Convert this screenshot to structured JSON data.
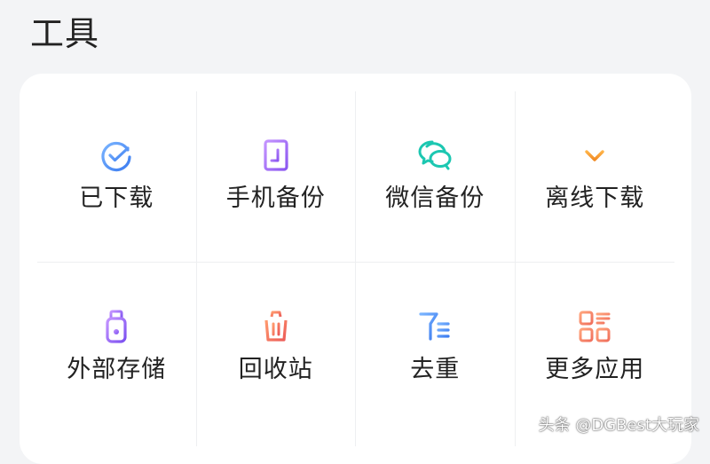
{
  "header": {
    "title": "工具"
  },
  "tools": [
    {
      "label": "已下载",
      "icon": "downloaded-check-icon"
    },
    {
      "label": "手机备份",
      "icon": "phone-backup-icon"
    },
    {
      "label": "微信备份",
      "icon": "wechat-backup-icon"
    },
    {
      "label": "离线下载",
      "icon": "offline-download-icon"
    },
    {
      "label": "外部存储",
      "icon": "usb-storage-icon"
    },
    {
      "label": "回收站",
      "icon": "recycle-bin-icon"
    },
    {
      "label": "去重",
      "icon": "dedupe-icon"
    },
    {
      "label": "更多应用",
      "icon": "more-apps-icon"
    }
  ],
  "watermark": "头条 @DGBest大玩家",
  "colors": {
    "background": "#f3f4f6",
    "card": "#ffffff",
    "text": "#222222",
    "blue": "#4f8ff7",
    "purple": "#a46bf3",
    "teal": "#1cc7b1",
    "orange": "#f5a13a",
    "red": "#f0725a",
    "salmon": "#f38c6c"
  }
}
